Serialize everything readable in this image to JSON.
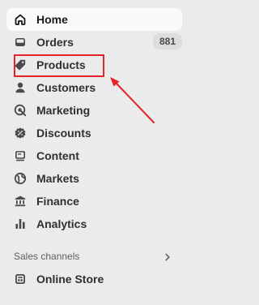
{
  "nav": {
    "items": [
      {
        "label": "Home",
        "icon": "home-icon",
        "active": true
      },
      {
        "label": "Orders",
        "icon": "inbox-icon",
        "badge": "881"
      },
      {
        "label": "Products",
        "icon": "tag-icon"
      },
      {
        "label": "Customers",
        "icon": "person-icon"
      },
      {
        "label": "Marketing",
        "icon": "target-icon"
      },
      {
        "label": "Discounts",
        "icon": "discount-icon"
      },
      {
        "label": "Content",
        "icon": "content-icon"
      },
      {
        "label": "Markets",
        "icon": "globe-icon"
      },
      {
        "label": "Finance",
        "icon": "bank-icon"
      },
      {
        "label": "Analytics",
        "icon": "bar-chart-icon"
      }
    ]
  },
  "sales_channels": {
    "title": "Sales channels",
    "items": [
      {
        "label": "Online Store",
        "icon": "store-icon"
      }
    ]
  },
  "annotation": {
    "highlight_color": "#e3242b"
  }
}
